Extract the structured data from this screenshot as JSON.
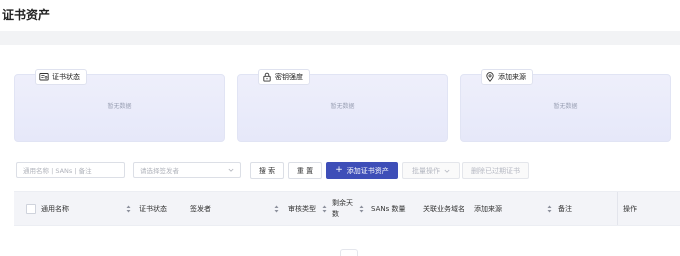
{
  "page": {
    "title": "证书资产"
  },
  "cards": [
    {
      "title": "证书状态",
      "icon": "certificate-icon",
      "empty_text": "暂无数据"
    },
    {
      "title": "密钥强度",
      "icon": "lock-icon",
      "empty_text": "暂无数据"
    },
    {
      "title": "添加来源",
      "icon": "location-pin-icon",
      "empty_text": "暂无数据"
    }
  ],
  "filters": {
    "search_placeholder": "通用名称 | SANs | 备注",
    "issuer_placeholder": "请选择签发者"
  },
  "toolbar": {
    "search_label": "搜 索",
    "reset_label": "重 置",
    "add_label": "添加证书资产",
    "batch_label": "批量操作",
    "delete_expired_label": "删除已过期证书"
  },
  "table": {
    "columns": [
      {
        "label": "通用名称",
        "sortable": true
      },
      {
        "label": "证书状态",
        "sortable": false
      },
      {
        "label": "签发者",
        "sortable": true
      },
      {
        "label": "审核类型",
        "sortable": true
      },
      {
        "label": "剩余天数",
        "sortable": true
      },
      {
        "label": "SANs 数量",
        "sortable": false
      },
      {
        "label": "关联业务域名",
        "sortable": false
      },
      {
        "label": "添加来源",
        "sortable": true
      },
      {
        "label": "备注",
        "sortable": false
      },
      {
        "label": "操作",
        "sortable": false
      }
    ]
  },
  "colors": {
    "primary": "#3e4eb8",
    "card_bg": "#e8eaf9"
  }
}
